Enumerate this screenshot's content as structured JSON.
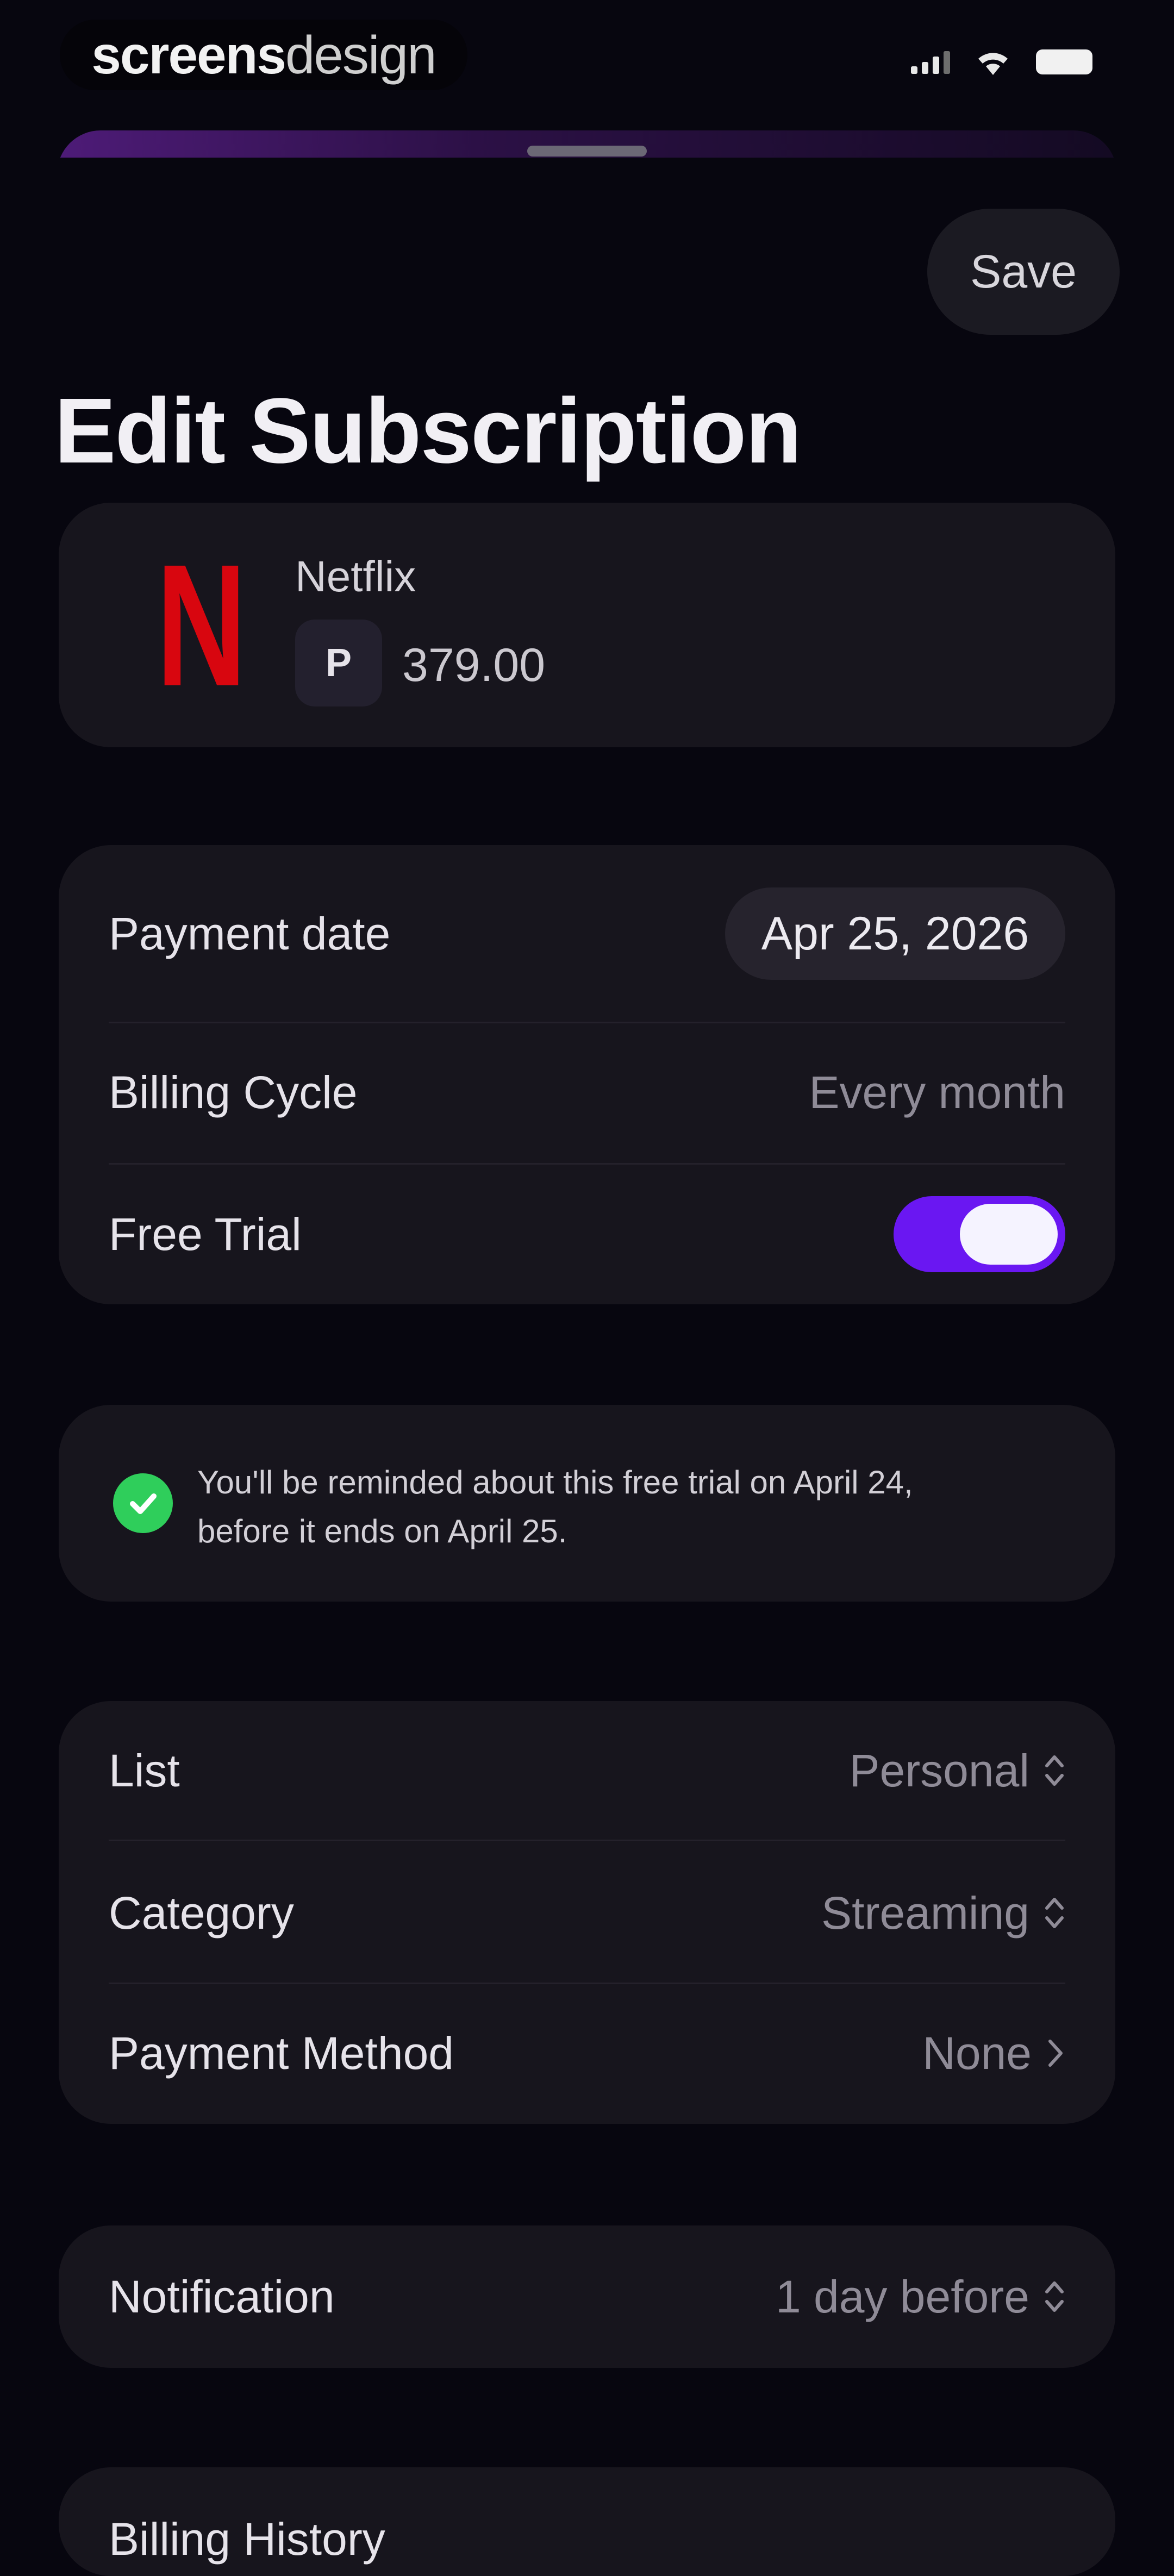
{
  "status_bar": {
    "watermark_bold": "screens",
    "watermark_light": "design"
  },
  "header": {
    "save_label": "Save",
    "title": "Edit Subscription"
  },
  "subscription": {
    "logo_letter": "N",
    "name": "Netflix",
    "currency_symbol": "P",
    "price": "379.00",
    "brand_color": "#d8060f"
  },
  "billing": {
    "payment_date_label": "Payment date",
    "payment_date_value": "Apr 25, 2026",
    "billing_cycle_label": "Billing Cycle",
    "billing_cycle_value": "Every month",
    "free_trial_label": "Free Trial",
    "free_trial_on": true,
    "toggle_color": "#6a17f2"
  },
  "reminder": {
    "line1": "You'll be reminded about this free trial on April 24,",
    "line2": "before it ends on April 25.",
    "icon_color": "#2fce5b"
  },
  "meta": {
    "list_label": "List",
    "list_value": "Personal",
    "category_label": "Category",
    "category_value": "Streaming",
    "payment_method_label": "Payment Method",
    "payment_method_value": "None"
  },
  "notification": {
    "label": "Notification",
    "value": "1 day before"
  },
  "history": {
    "label": "Billing History"
  }
}
